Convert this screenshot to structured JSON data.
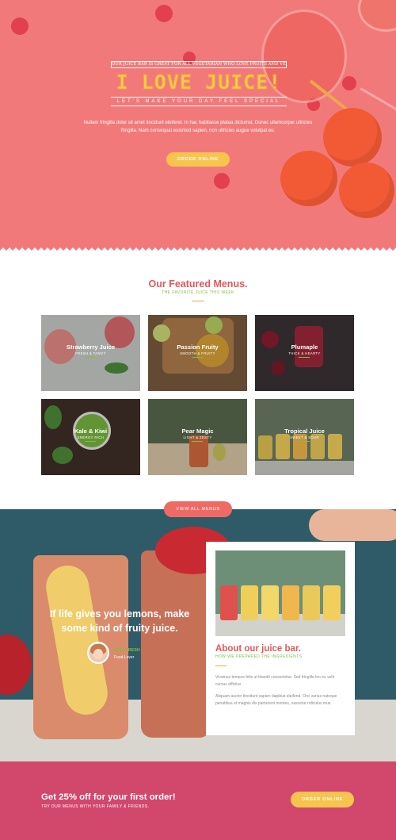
{
  "hero": {
    "kicker": "OUR JUICE BAR IS GREAT FOR ALL VEGETARIAN WHO LOVE FRUITS AND VEGETABLES",
    "title": "I LOVE JUICE!",
    "subtitle": "LET'S MAKE YOUR DAY FEEL SPECIAL",
    "description": "Nullam fringilla dolor sit amet tincidunt eleifend. In hac habitasse platea dictumst. Donec ullamcorper ultricies fringilla. Nam consequat euismod sapien, non ultricies augue volutpat eu.",
    "button": "ORDER ONLINE"
  },
  "featured": {
    "title": "Our Featured Menus.",
    "subtitle": "THE FAVORITE JUICE THIS WEEK",
    "items": [
      {
        "name": "Strawberry Juice",
        "desc": "FRESH & TANGY"
      },
      {
        "name": "Passion Fruity",
        "desc": "SMOOTH & FRUITY"
      },
      {
        "name": "Plumaple",
        "desc": "THICK & HEARTY"
      },
      {
        "name": "Kale & Kiwi",
        "desc": "ENERGY RICH"
      },
      {
        "name": "Pear Magic",
        "desc": "LIGHT & ZESTY"
      },
      {
        "name": "Tropical Juice",
        "desc": "SWEET & SOUR"
      }
    ],
    "view_button": "VIEW ALL MENUS"
  },
  "testimonial": {
    "quote": "If life gives you lemons, make some kind of fruity juice.",
    "name": "DINA FRESH",
    "role": "Food Lover"
  },
  "about": {
    "title": "About our juice bar.",
    "subtitle": "HOW WE PREPARED THE INGREDIENTS",
    "p1": "Vivamus tempus felis ut blandit consectetur. Sed fringilla leo eu velit cursus efficitur.",
    "p2": "Aliquam auctor tincidunt sapien dapibus eleifend. Orci varius natoque penatibus et magnis dis parturient montes, nascetur ridiculus mus."
  },
  "promo": {
    "title": "Get 25% off for your first order!",
    "subtitle": "TRY OUR MENUS WITH YOUR FAMILY & FRIENDS.",
    "button": "ORDER ONLINE"
  },
  "colors": {
    "hero_bg": "#f2797a",
    "accent_red": "#e25759",
    "accent_green": "#7fbf3f",
    "button_yellow": "#f7c54e",
    "promo_bg": "#d2476c"
  }
}
